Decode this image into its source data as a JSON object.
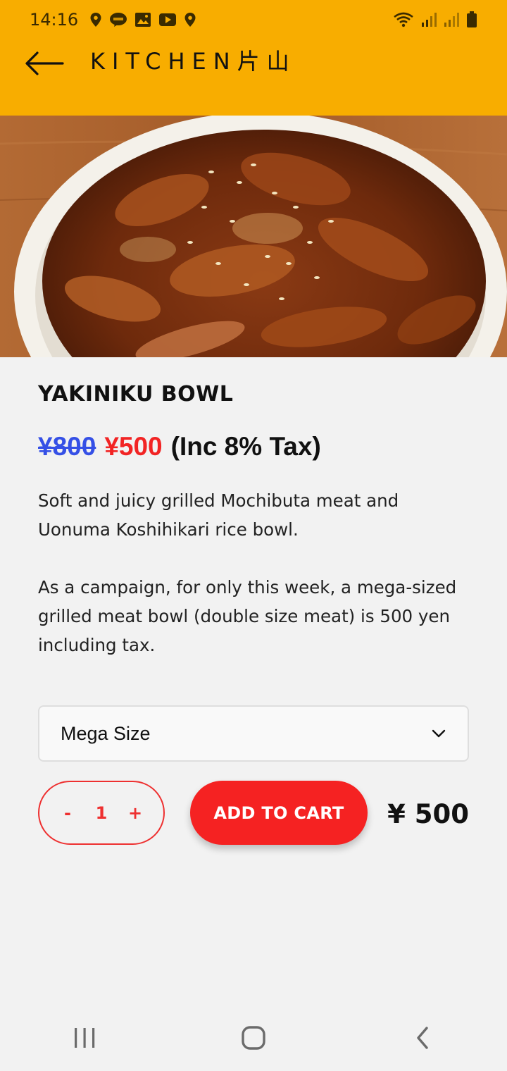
{
  "status_bar": {
    "time": "14:16",
    "left_icons": [
      "location-pin-icon",
      "line-app-icon",
      "image-icon",
      "youtube-icon",
      "location-pin-icon"
    ],
    "right_icons": [
      "wifi-icon",
      "signal-icon",
      "signal-icon",
      "battery-icon"
    ]
  },
  "header": {
    "title": "KITCHEN片山",
    "back_icon": "arrow-left-icon",
    "background": "#f8ad00"
  },
  "product": {
    "name": "YAKINIKU BOWL",
    "old_price": "¥800",
    "new_price": "¥500",
    "tax_note": "(Inc 8% Tax)",
    "description_1": "Soft and juicy grilled Mochibuta meat and Uonuma Koshihikari rice bowl.",
    "description_2": "As a campaign, for only this week, a mega-sized grilled meat bowl (double size meat) is 500 yen including tax."
  },
  "size_select": {
    "selected": "Mega Size"
  },
  "cart": {
    "minus": "-",
    "quantity": "1",
    "plus": "+",
    "add_label": "ADD TO CART",
    "total": "¥ 500"
  },
  "colors": {
    "header": "#f8ad00",
    "accent_red": "#f52222",
    "old_price_blue": "#3550e6"
  },
  "nav_bar": {
    "buttons": [
      "recent-apps-icon",
      "home-icon",
      "back-icon"
    ]
  }
}
